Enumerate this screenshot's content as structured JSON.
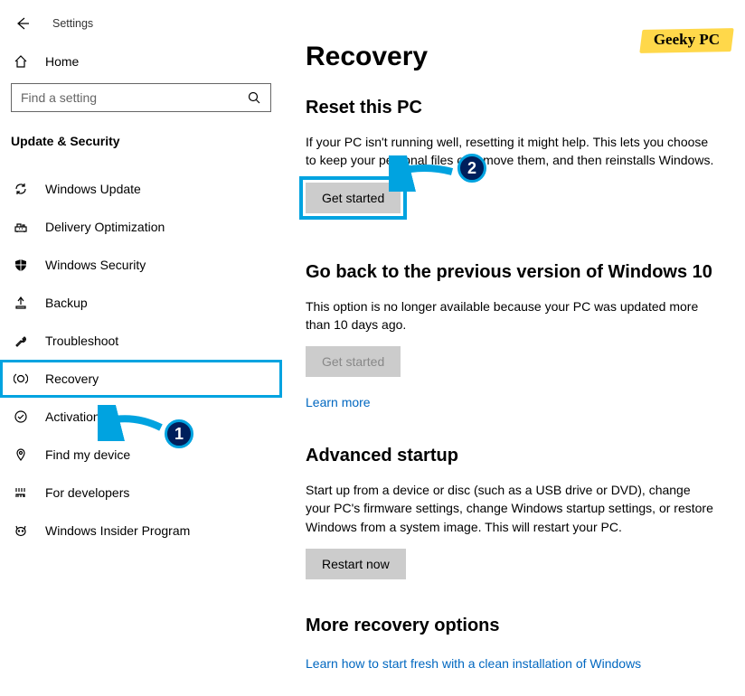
{
  "header": {
    "app_title": "Settings",
    "home_label": "Home",
    "search_placeholder": "Find a setting",
    "section_header": "Update & Security"
  },
  "sidebar": {
    "items": [
      {
        "label": "Windows Update",
        "icon": "sync"
      },
      {
        "label": "Delivery Optimization",
        "icon": "delivery"
      },
      {
        "label": "Windows Security",
        "icon": "shield"
      },
      {
        "label": "Backup",
        "icon": "backup"
      },
      {
        "label": "Troubleshoot",
        "icon": "wrench"
      },
      {
        "label": "Recovery",
        "icon": "recovery",
        "highlighted": true
      },
      {
        "label": "Activation",
        "icon": "check"
      },
      {
        "label": "Find my device",
        "icon": "location"
      },
      {
        "label": "For developers",
        "icon": "dev"
      },
      {
        "label": "Windows Insider Program",
        "icon": "insider"
      }
    ]
  },
  "main": {
    "page_title": "Recovery",
    "sections": {
      "reset": {
        "title": "Reset this PC",
        "desc": "If your PC isn't running well, resetting it might help. This lets you choose to keep your personal files or remove them, and then reinstalls Windows.",
        "button": "Get started"
      },
      "goback": {
        "title": "Go back to the previous version of Windows 10",
        "desc": "This option is no longer available because your PC was updated more than 10 days ago.",
        "button": "Get started",
        "link": "Learn more"
      },
      "advanced": {
        "title": "Advanced startup",
        "desc": "Start up from a device or disc (such as a USB drive or DVD), change your PC's firmware settings, change Windows startup settings, or restore Windows from a system image. This will restart your PC.",
        "button": "Restart now"
      },
      "more": {
        "title": "More recovery options",
        "link": "Learn how to start fresh with a clean installation of Windows"
      }
    }
  },
  "annotations": {
    "callout1": "1",
    "callout2": "2"
  },
  "watermark": "Geeky PC"
}
